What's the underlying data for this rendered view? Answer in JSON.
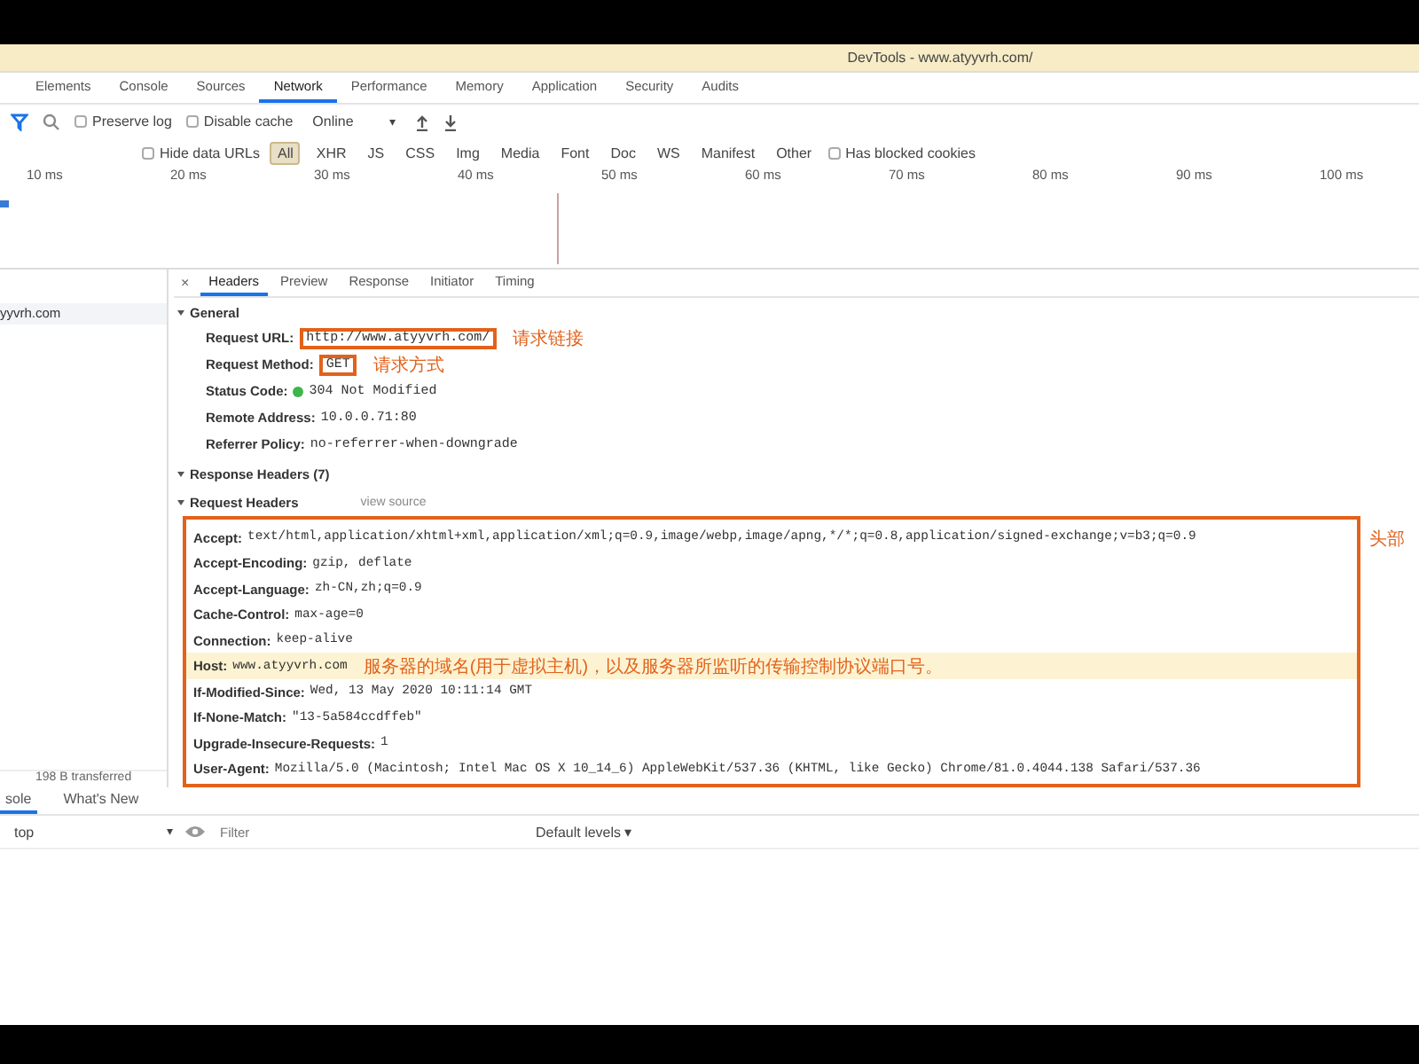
{
  "window": {
    "title": "DevTools - www.atyyvrh.com/"
  },
  "tabs": [
    {
      "label": "Elements",
      "selected": false
    },
    {
      "label": "Console",
      "selected": false
    },
    {
      "label": "Sources",
      "selected": false
    },
    {
      "label": "Network",
      "selected": true
    },
    {
      "label": "Performance",
      "selected": false
    },
    {
      "label": "Memory",
      "selected": false
    },
    {
      "label": "Application",
      "selected": false
    },
    {
      "label": "Security",
      "selected": false
    },
    {
      "label": "Audits",
      "selected": false
    }
  ],
  "toolbar": {
    "preserve_log": {
      "label": "Preserve log",
      "checked": false
    },
    "disable_cache": {
      "label": "Disable cache",
      "checked": false
    },
    "throttling": "Online"
  },
  "filters": {
    "hide_data_urls": {
      "label": "Hide data URLs",
      "checked": false
    },
    "types": [
      {
        "label": "All",
        "selected": true
      },
      {
        "label": "XHR",
        "selected": false
      },
      {
        "label": "JS",
        "selected": false
      },
      {
        "label": "CSS",
        "selected": false
      },
      {
        "label": "Img",
        "selected": false
      },
      {
        "label": "Media",
        "selected": false
      },
      {
        "label": "Font",
        "selected": false
      },
      {
        "label": "Doc",
        "selected": false
      },
      {
        "label": "WS",
        "selected": false
      },
      {
        "label": "Manifest",
        "selected": false
      },
      {
        "label": "Other",
        "selected": false
      }
    ],
    "blocked_cookies": {
      "label": "Has blocked cookies",
      "checked": false
    }
  },
  "timeline": {
    "ticks": [
      "10 ms",
      "20 ms",
      "30 ms",
      "40 ms",
      "50 ms",
      "60 ms",
      "70 ms",
      "80 ms",
      "90 ms",
      "100 ms"
    ]
  },
  "requests": [
    {
      "name": "yyvrh.com",
      "selected": true
    }
  ],
  "summary": "198 B transferred",
  "detail_tabs": [
    {
      "label": "Headers",
      "selected": true
    },
    {
      "label": "Preview",
      "selected": false
    },
    {
      "label": "Response",
      "selected": false
    },
    {
      "label": "Initiator",
      "selected": false
    },
    {
      "label": "Timing",
      "selected": false
    }
  ],
  "close": "×",
  "general": {
    "title": "General",
    "rows": [
      {
        "kind": "text",
        "name": "Request URL:",
        "value": "http://www.atyyvrh.com/",
        "note": "请求链接"
      },
      {
        "kind": "text",
        "name": "Request Method:",
        "value": "GET",
        "note": "请求方式"
      },
      {
        "kind": "status",
        "name": "Status Code:",
        "value": "304 Not Modified",
        "color": "#3db54a"
      },
      {
        "kind": "text",
        "name": "Remote Address:",
        "value": "10.0.0.71:80"
      },
      {
        "kind": "text",
        "name": "Referrer Policy:",
        "value": "no-referrer-when-downgrade"
      }
    ]
  },
  "response_headers": {
    "title": "Response Headers (7)"
  },
  "request_headers": {
    "title": "Request Headers",
    "link": "view source",
    "side_note": "头部",
    "rows": [
      {
        "name": "Accept:",
        "value": "text/html,application/xhtml+xml,application/xml;q=0.9,image/webp,image/apng,*/*;q=0.8,application/signed-exchange;v=b3;q=0.9",
        "highlighted": false
      },
      {
        "name": "Accept-Encoding:",
        "value": "gzip, deflate",
        "highlighted": false
      },
      {
        "name": "Accept-Language:",
        "value": "zh-CN,zh;q=0.9",
        "highlighted": false
      },
      {
        "name": "Cache-Control:",
        "value": "max-age=0",
        "highlighted": false
      },
      {
        "name": "Connection:",
        "value": "keep-alive",
        "highlighted": false
      },
      {
        "name": "Host:",
        "value": "www.atyyvrh.com",
        "highlighted": true,
        "note": "服务器的域名(用于虚拟主机)，以及服务器所监听的传输控制协议端口号。"
      },
      {
        "name": "If-Modified-Since:",
        "value": "Wed, 13 May 2020 10:11:14 GMT",
        "highlighted": false
      },
      {
        "name": "If-None-Match:",
        "value": "\"13-5a584ccdffeb\"",
        "highlighted": false
      },
      {
        "name": "Upgrade-Insecure-Requests:",
        "value": "1",
        "highlighted": false
      },
      {
        "name": "User-Agent:",
        "value": "Mozilla/5.0 (Macintosh; Intel Mac OS X 10_14_6) AppleWebKit/537.36 (KHTML, like Gecko) Chrome/81.0.4044.138 Safari/537.36",
        "highlighted": false
      }
    ]
  },
  "drawer": {
    "tabs": [
      {
        "label": "sole",
        "selected": true
      },
      {
        "label": "What's New",
        "selected": false
      }
    ],
    "context": "top",
    "filter_placeholder": "Filter",
    "levels": "Default levels ▾",
    "caret": "▾"
  }
}
